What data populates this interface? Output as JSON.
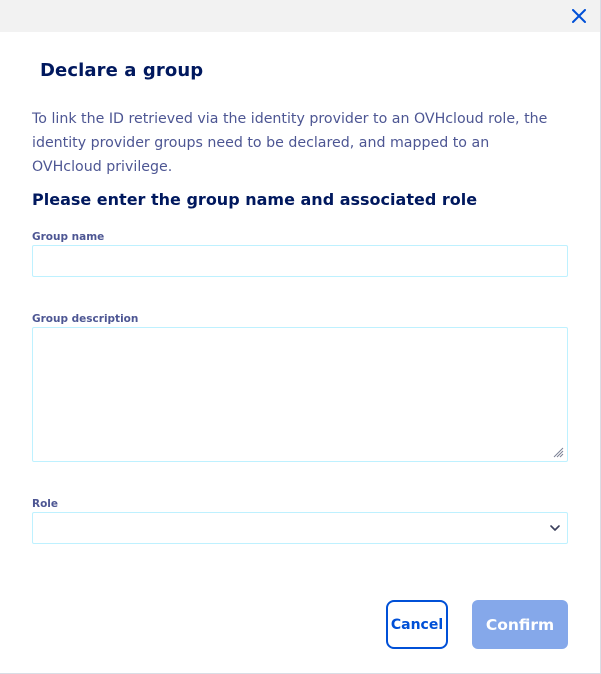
{
  "modal": {
    "title": "Declare a group",
    "description": "To link the ID retrieved via the identity provider to an OVHcloud role, the identity provider groups need to be declared, and mapped to an OVHcloud privilege.",
    "subtitle": "Please enter the group name and associated role",
    "close_icon": "close-icon"
  },
  "form": {
    "group_name": {
      "label": "Group name",
      "value": ""
    },
    "group_description": {
      "label": "Group description",
      "value": ""
    },
    "role": {
      "label": "Role",
      "selected": ""
    }
  },
  "actions": {
    "cancel_label": "Cancel",
    "confirm_label": "Confirm"
  },
  "colors": {
    "primary": "#0050d7",
    "title": "#00185e",
    "text": "#4d5693",
    "input_border": "#bef1ff",
    "confirm_disabled": "#85a8ea",
    "header_bar": "#f2f2f2"
  }
}
